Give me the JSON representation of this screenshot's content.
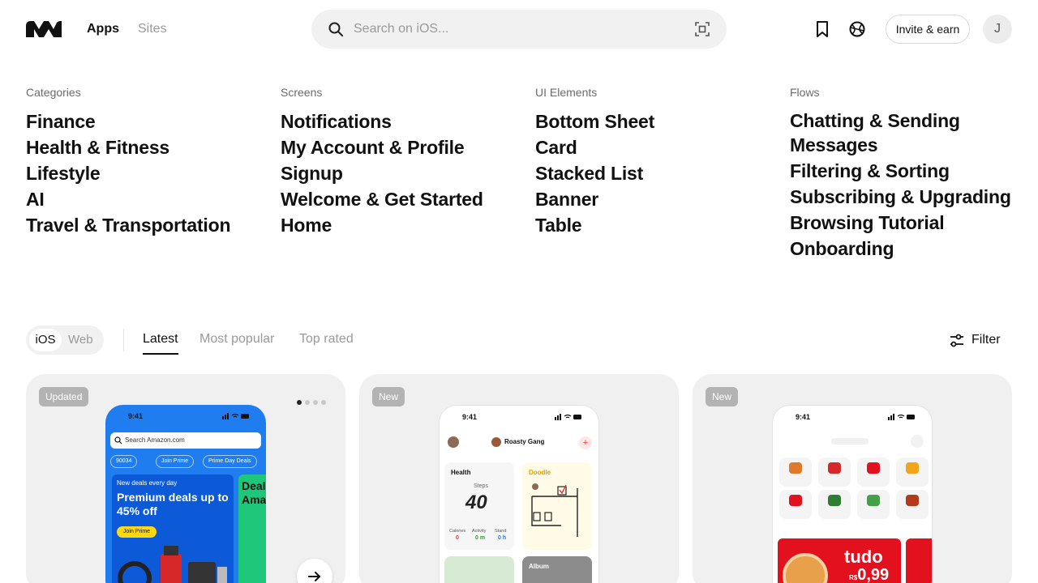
{
  "header": {
    "logo_icon": "mobbin-logo-icon",
    "nav": {
      "apps": "Apps",
      "sites": "Sites"
    },
    "search": {
      "placeholder": "Search on iOS...",
      "icon": "search-icon",
      "scan_icon": "scan-icon"
    },
    "bookmark_icon": "bookmark-icon",
    "globe_icon": "globe-icon",
    "invite_label": "Invite & earn",
    "avatar_initial": "J"
  },
  "categories": {
    "col1": {
      "heading": "Categories",
      "items": [
        "Finance",
        "Health & Fitness",
        "Lifestyle",
        "AI",
        "Travel & Transportation"
      ]
    },
    "col2": {
      "heading": "Screens",
      "items": [
        "Notifications",
        "My Account & Profile",
        "Signup",
        "Welcome & Get Started",
        "Home"
      ]
    },
    "col3": {
      "heading": "UI Elements",
      "items": [
        "Bottom Sheet",
        "Card",
        "Stacked List",
        "Banner",
        "Table"
      ]
    },
    "col4": {
      "heading": "Flows",
      "items": [
        "Chatting & Sending Messages",
        "Filtering & Sorting",
        "Subscribing & Upgrading",
        "Browsing Tutorial",
        "Onboarding"
      ]
    }
  },
  "filters": {
    "platform": {
      "ios": "iOS",
      "web": "Web",
      "selected": "iOS"
    },
    "tabs": {
      "latest": "Latest",
      "popular": "Most popular",
      "top": "Top rated",
      "selected": "Latest"
    },
    "filter_label": "Filter",
    "filter_icon": "filter-sliders-icon"
  },
  "cards": [
    {
      "badge": "Updated",
      "dots": {
        "count": 4,
        "active": 1
      },
      "phone": {
        "time": "9:41",
        "search": "Search Amazon.com",
        "pills": [
          "90034",
          "Join Prime",
          "Prime Day Deals"
        ],
        "banner_small": "New deals every day",
        "banner_big": "Premium deals up to 45% off",
        "banner_button": "Join Prime",
        "banner2_text": "Deal Ama"
      }
    },
    {
      "badge": "New",
      "phone": {
        "time": "9:41",
        "title": "Roasty Gang",
        "health": "Health",
        "steps_label": "Steps",
        "steps_value": "40",
        "stats": [
          "Calories",
          "Activity",
          "Stand"
        ],
        "stat_values": [
          "0",
          "0 m",
          "0 h"
        ],
        "doodle": "Doodle",
        "album": "Album"
      }
    },
    {
      "badge": "New",
      "phone": {
        "time": "9:41",
        "promo_word": "tudo",
        "promo_currency": "R$",
        "promo_price": "0,99"
      }
    }
  ],
  "colors": {
    "amazon_blue": "#1f7df0",
    "promo_red": "#e3101e",
    "badge_grey": "#b3b3b3"
  }
}
